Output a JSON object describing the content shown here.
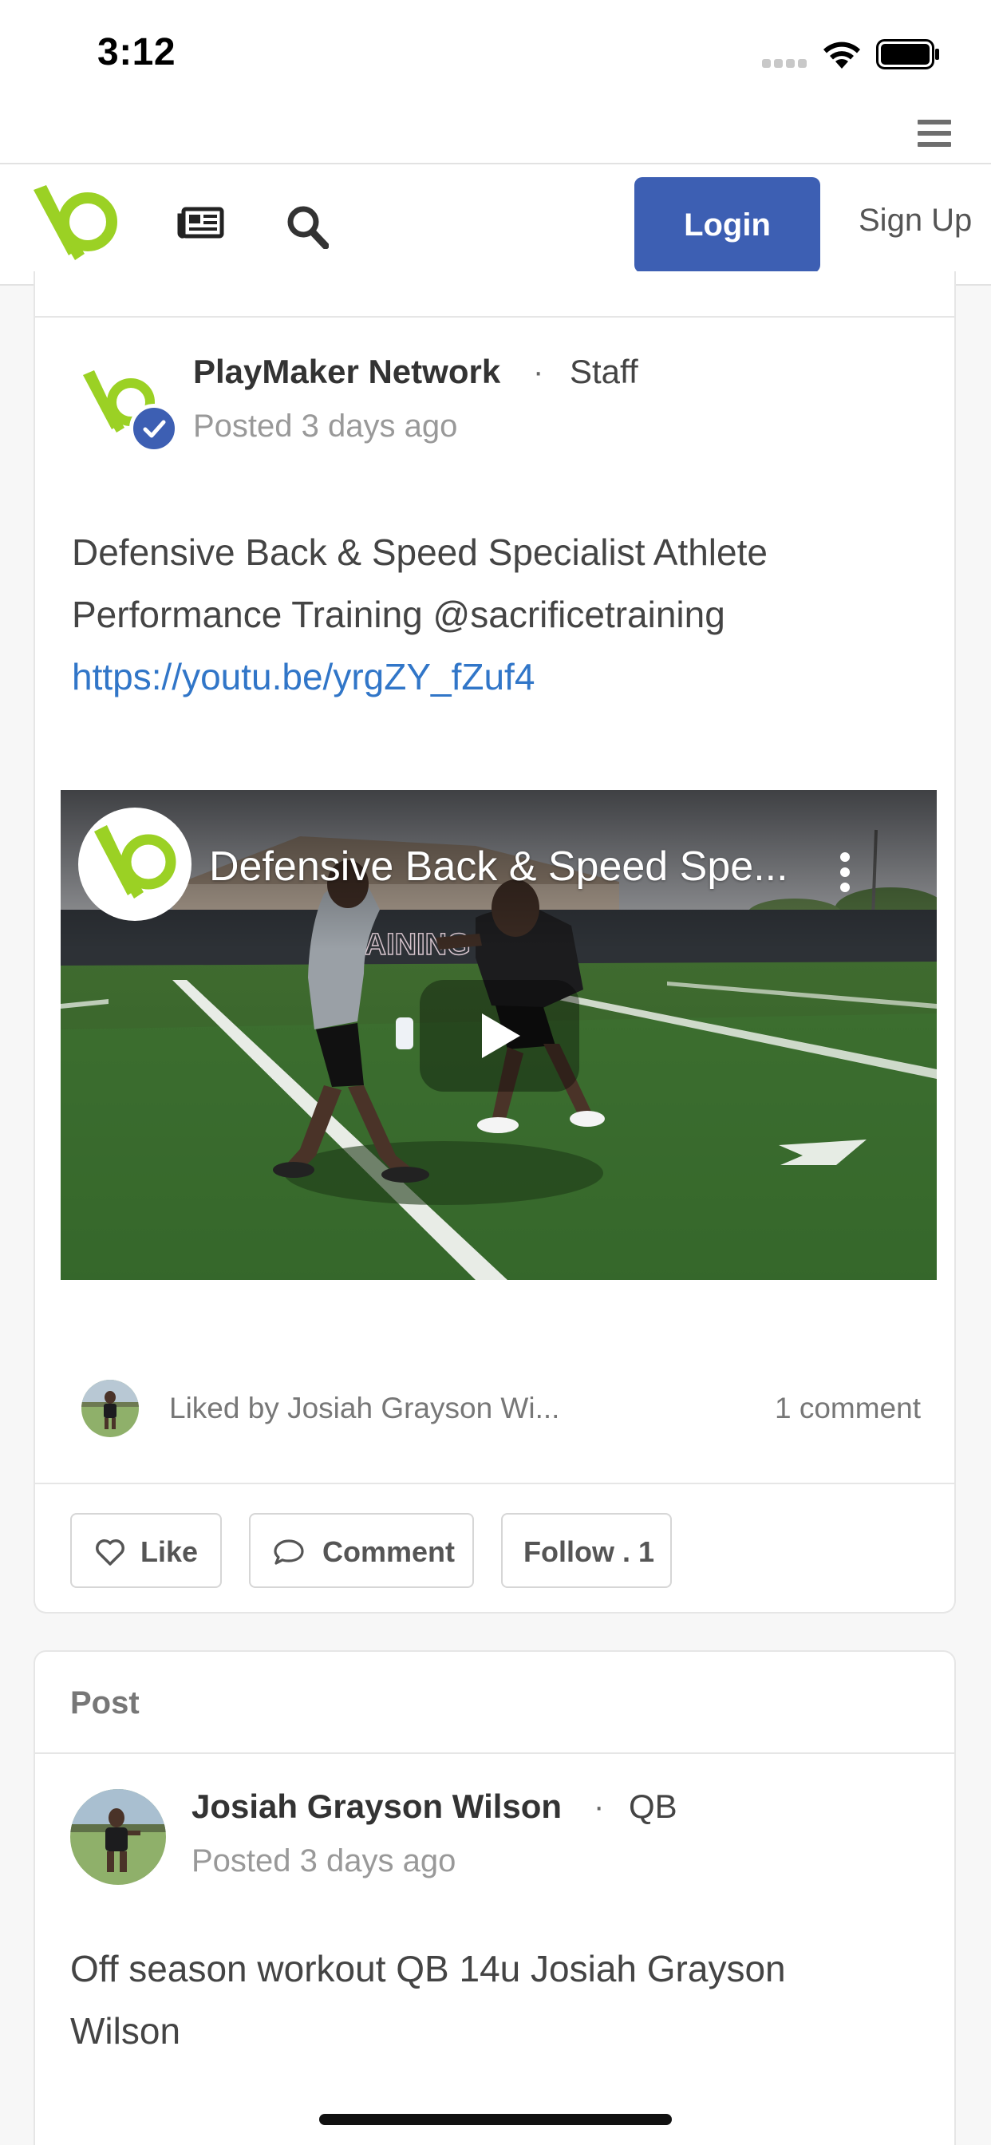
{
  "status_bar": {
    "time": "3:12"
  },
  "navbar": {
    "login_label": "Login",
    "signup_label": "Sign Up",
    "brand_color": "#3d5fb3",
    "logo_color": "#9bd124"
  },
  "post_1": {
    "author": "PlayMaker Network",
    "separator": "·",
    "role": "Staff",
    "posted": "Posted 3 days ago",
    "text": "Defensive Back & Speed Specialist Athlete Performance Training @sacrificetraining",
    "link": "https://youtu.be/yrgZY_fZuf4",
    "video": {
      "title": "Defensive Back & Speed Spe...",
      "banner_text": "TRAINING"
    },
    "liked_by": "Liked by Josiah Grayson Wi...",
    "comment_count": "1 comment",
    "actions": {
      "like": "Like",
      "comment": "Comment",
      "follow": "Follow . 1"
    }
  },
  "post_2": {
    "header": "Post",
    "author": "Josiah Grayson Wilson",
    "separator": "·",
    "role": "QB",
    "posted": "Posted 3 days ago",
    "text": "Off season workout QB 14u Josiah Grayson Wilson"
  }
}
